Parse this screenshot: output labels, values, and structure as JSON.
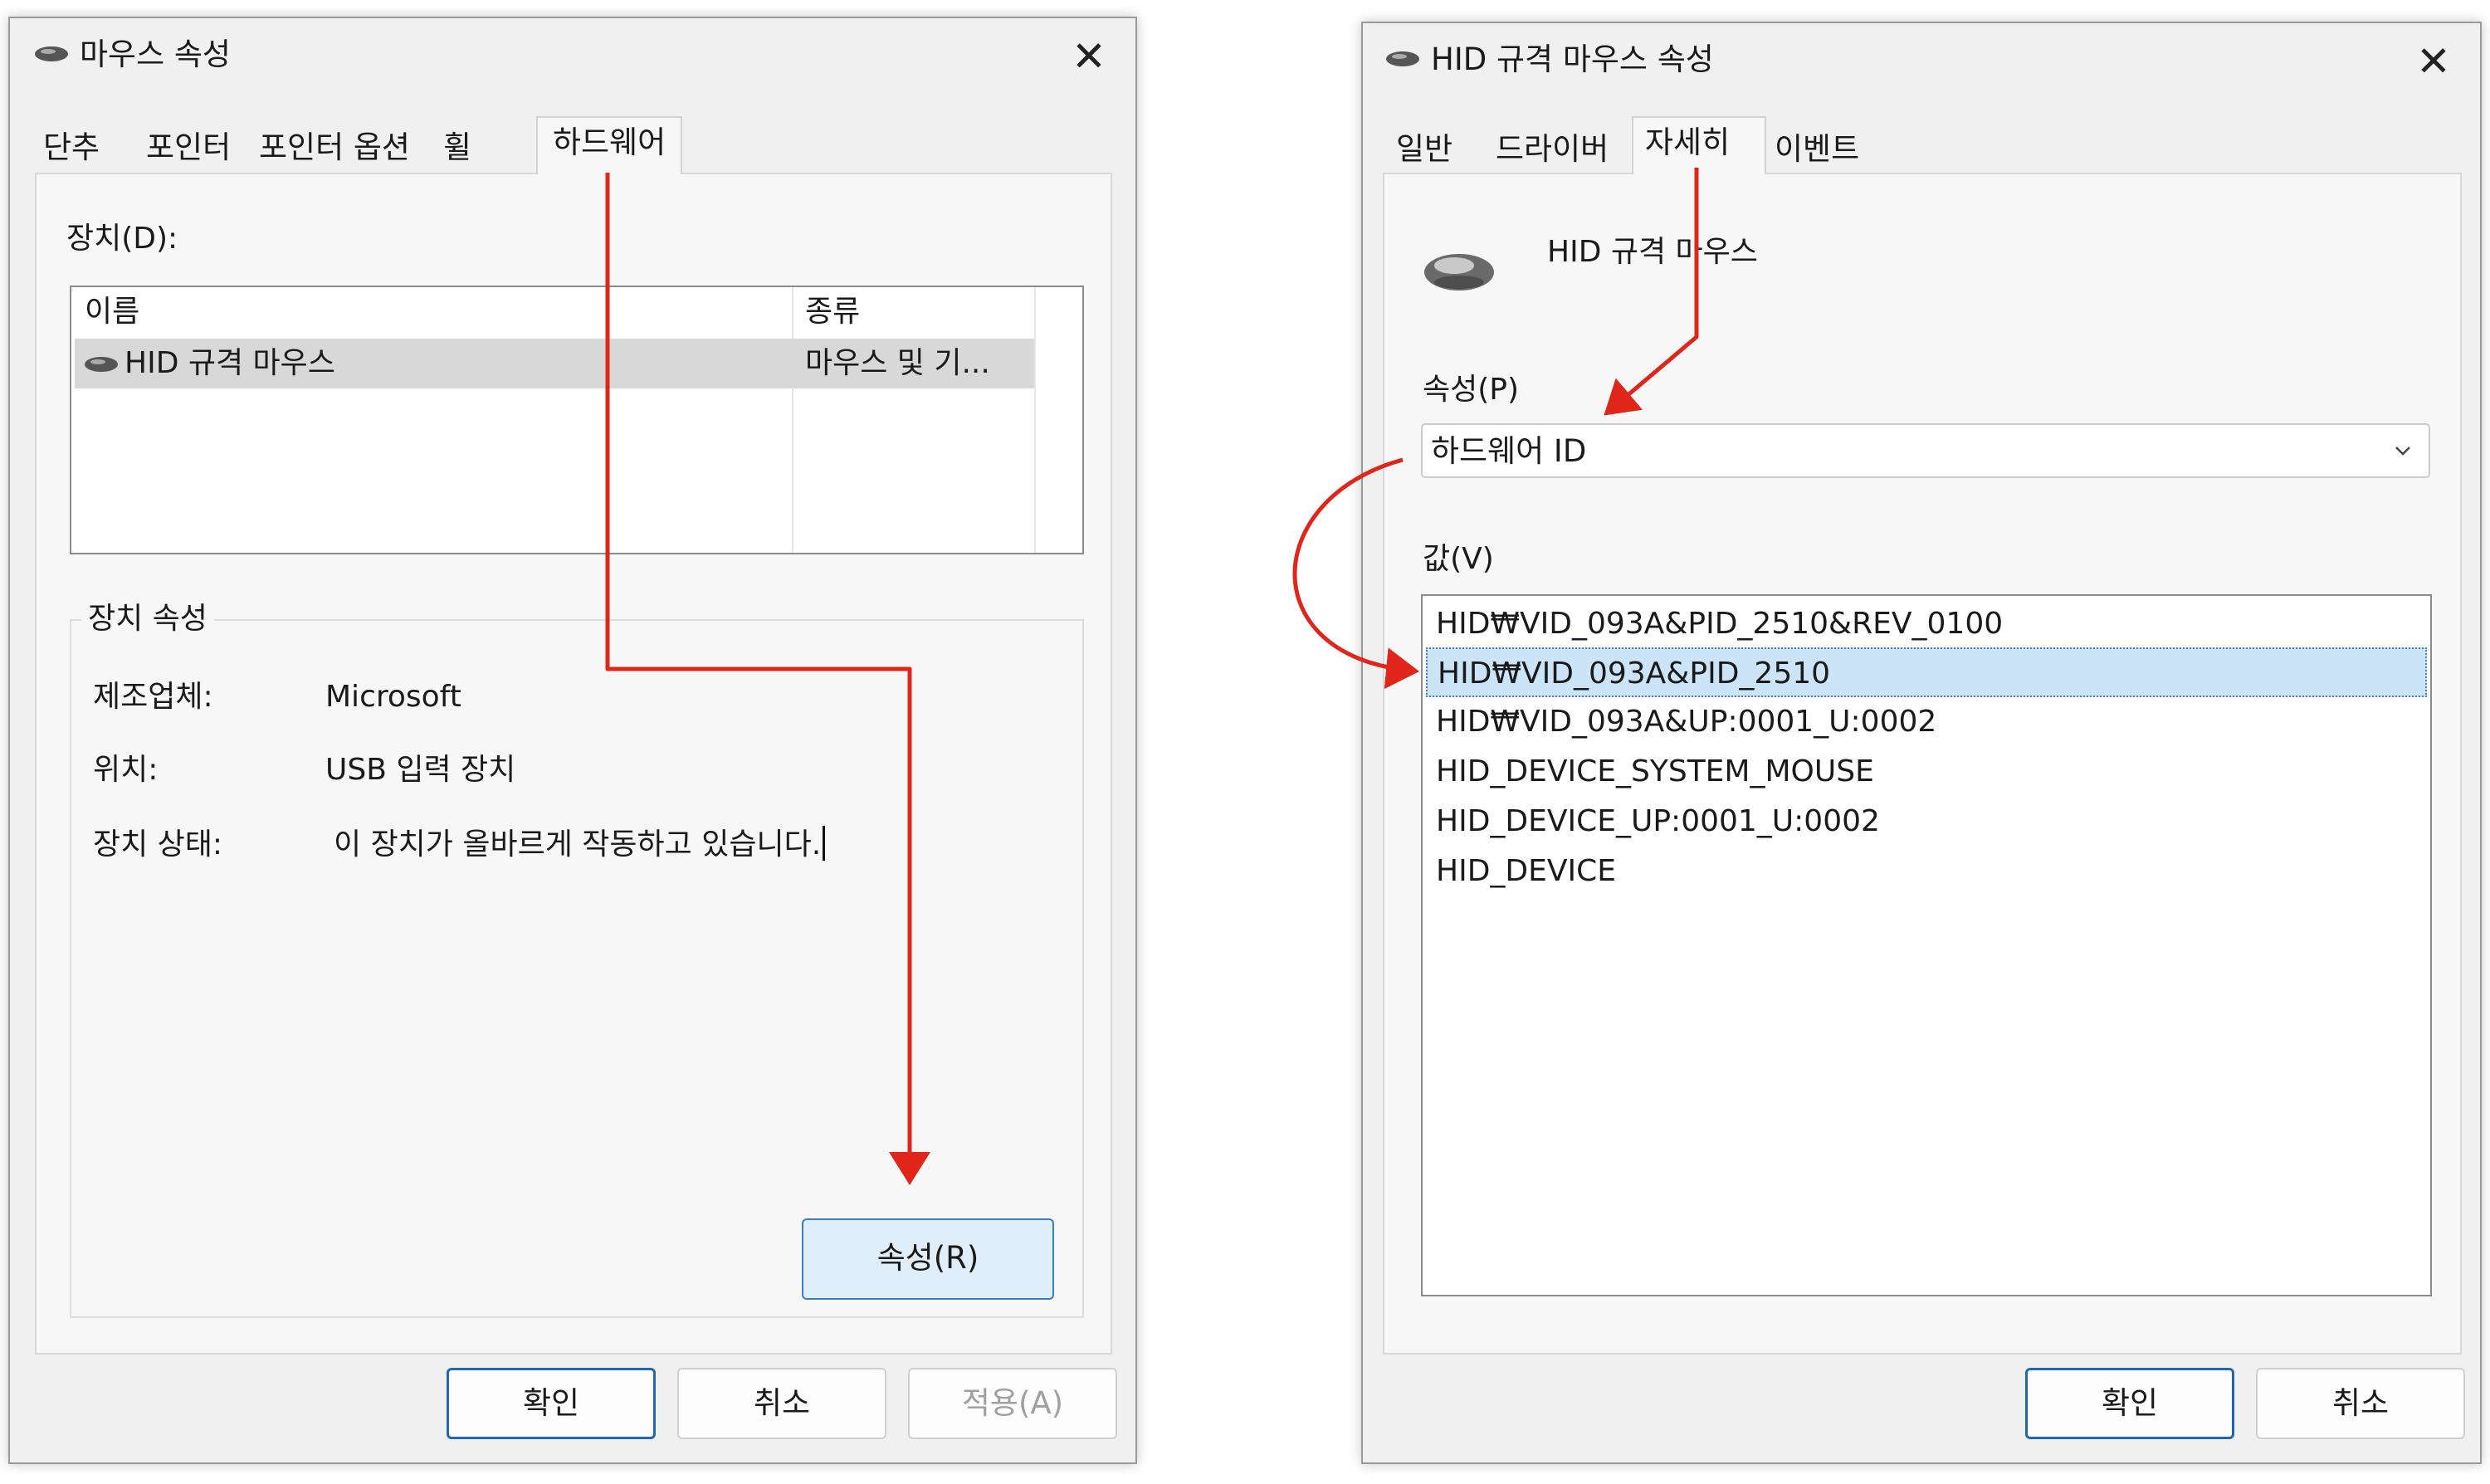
{
  "colors": {
    "annotation_arrow": "#e0261b",
    "selection": "#cce4f7",
    "default_button_border": "#1f66b7",
    "dialog_background": "#f0f0f0"
  },
  "mouse_properties_dialog": {
    "title": "마우스 속성",
    "title_icon": "mouse-icon",
    "close_icon": "close-icon",
    "close_symbol": "✕",
    "tabs": [
      {
        "label": "단추"
      },
      {
        "label": "포인터"
      },
      {
        "label": "포인터 옵션"
      },
      {
        "label": "휠"
      },
      {
        "label": "하드웨어",
        "selected": true
      }
    ],
    "devices_label": "장치(D):",
    "device_table": {
      "columns": [
        "이름",
        "종류"
      ],
      "rows": [
        {
          "name": "HID 규격 마우스",
          "type": "마우스 및 기...",
          "selected": true
        }
      ]
    },
    "device_properties": {
      "legend": "장치 속성",
      "manufacturer_label": "제조업체:",
      "manufacturer_value": "Microsoft",
      "location_label": "위치:",
      "location_value": "USB 입력 장치",
      "status_label": "장치 상태:",
      "status_value": "이 장치가 올바르게 작동하고 있습니다."
    },
    "properties_button": "속성(R)",
    "ok_button": "확인",
    "cancel_button": "취소",
    "apply_button": "적용(A)"
  },
  "hid_mouse_dialog": {
    "title": "HID 규격 마우스 속성",
    "title_icon": "mouse-icon",
    "close_icon": "close-icon",
    "close_symbol": "✕",
    "tabs": [
      {
        "label": "일반"
      },
      {
        "label": "드라이버"
      },
      {
        "label": "자세히",
        "selected": true
      },
      {
        "label": "이벤트"
      }
    ],
    "device_name": "HID 규격 마우스",
    "property_label": "속성(P)",
    "property_selected": "하드웨어 ID",
    "value_label": "값(V)",
    "values": [
      "HID₩VID_093A&PID_2510&REV_0100",
      "HID₩VID_093A&PID_2510",
      "HID₩VID_093A&UP:0001_U:0002",
      "HID_DEVICE_SYSTEM_MOUSE",
      "HID_DEVICE_UP:0001_U:0002",
      "HID_DEVICE"
    ],
    "selected_value_index": 1,
    "ok_button": "확인",
    "cancel_button": "취소"
  }
}
